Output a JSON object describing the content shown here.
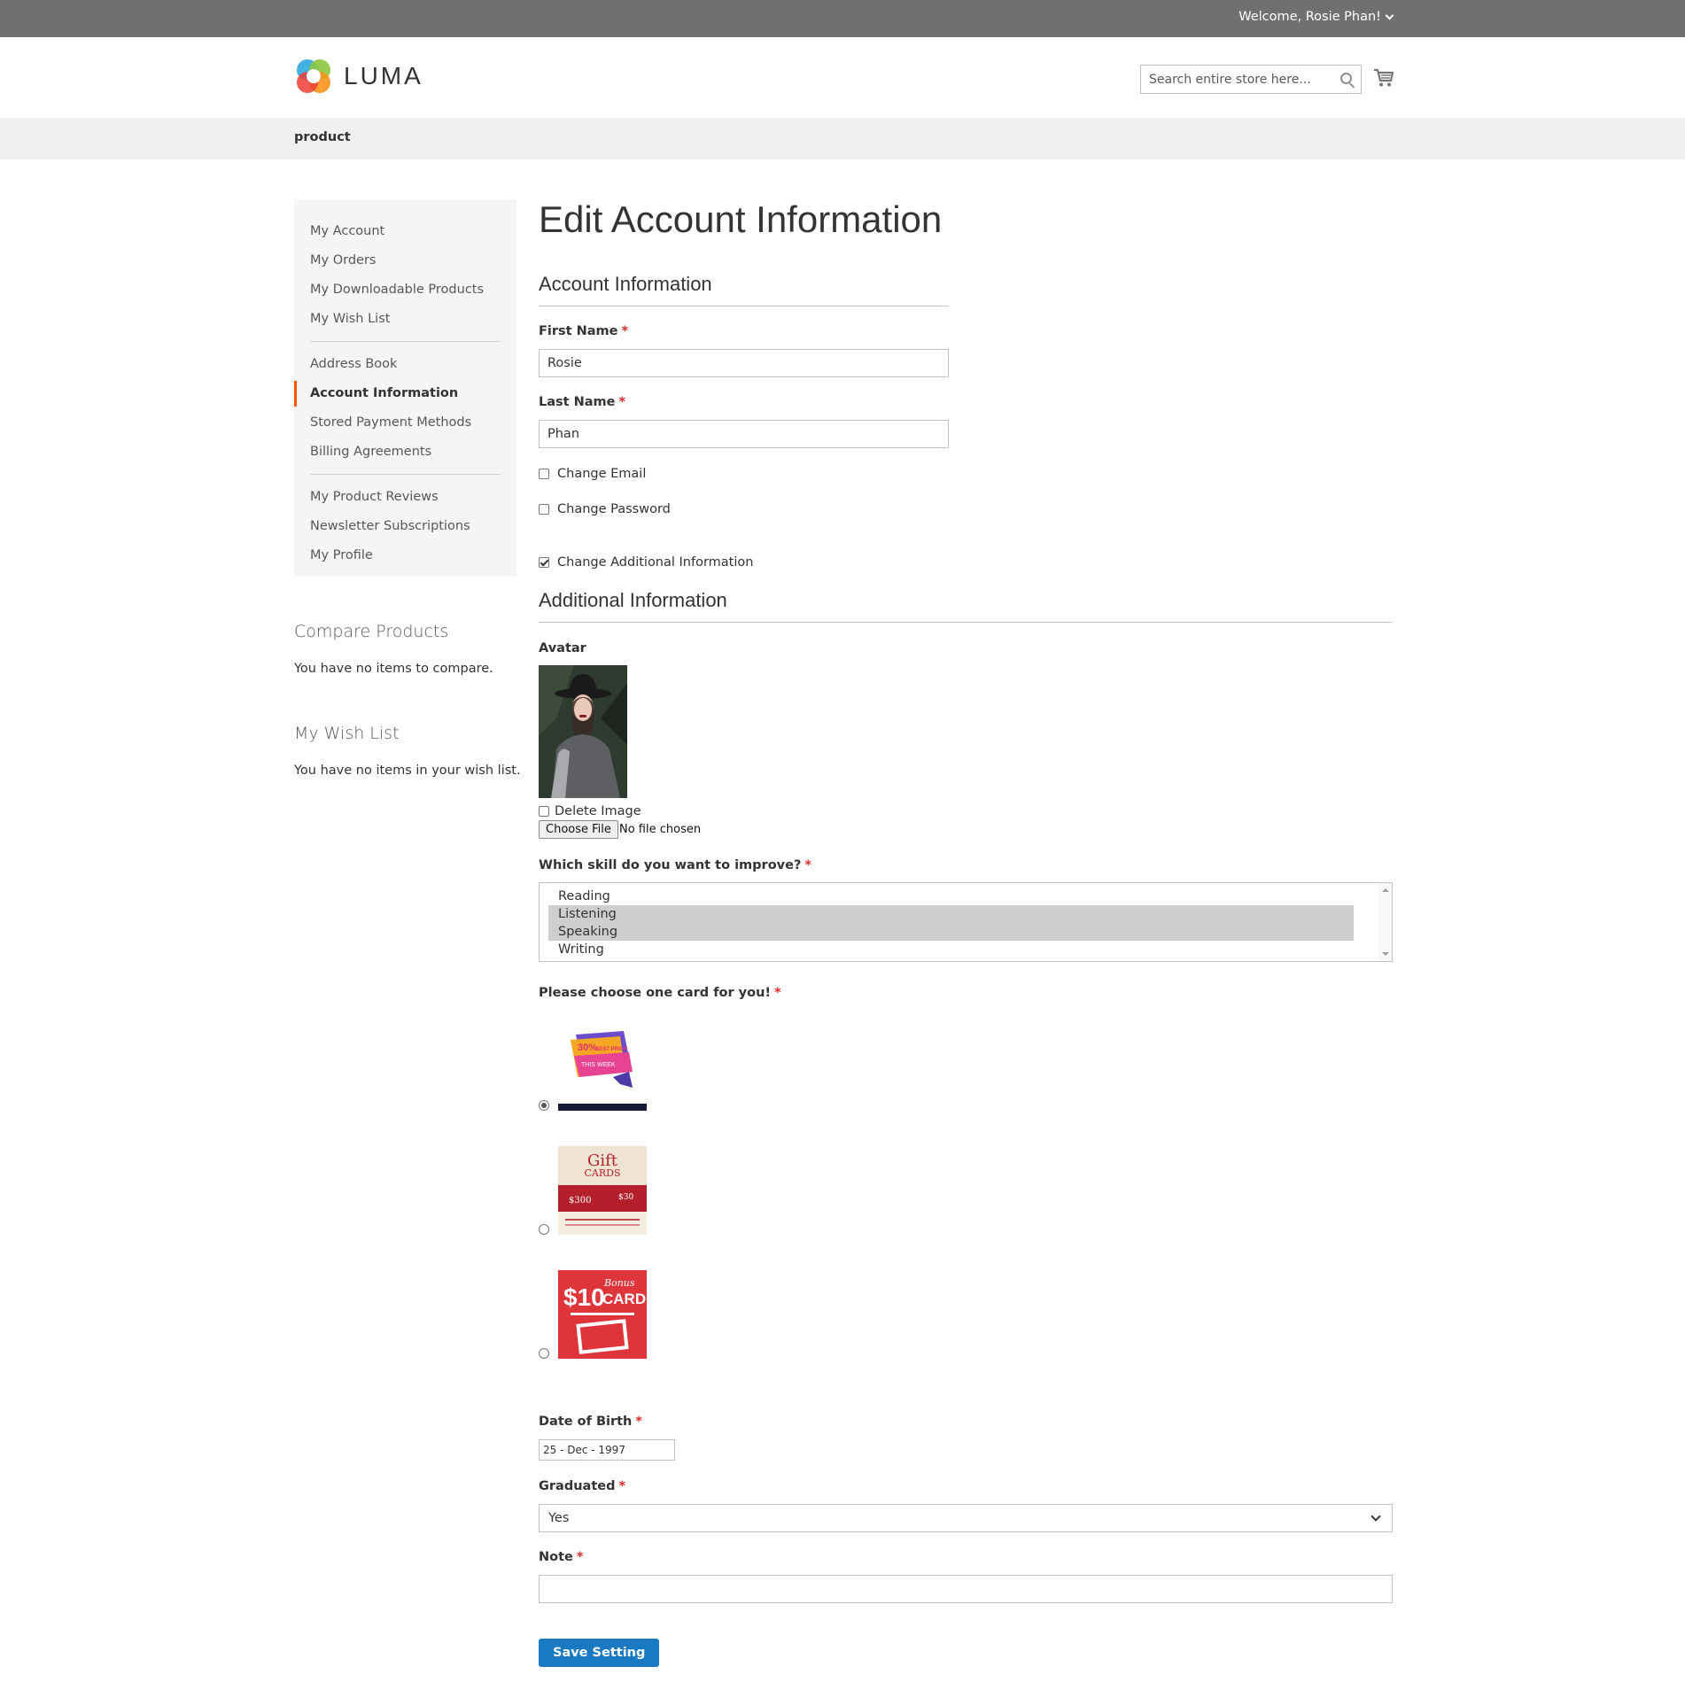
{
  "header": {
    "welcome": "Welcome, Rosie Phan!",
    "logo_text": "LUMA",
    "search_placeholder": "Search entire store here..."
  },
  "breadcrumb": "product",
  "sidebar": {
    "group1": [
      "My Account",
      "My Orders",
      "My Downloadable Products",
      "My Wish List"
    ],
    "group2": [
      "Address Book",
      "Account Information",
      "Stored Payment Methods",
      "Billing Agreements"
    ],
    "group3": [
      "My Product Reviews",
      "Newsletter Subscriptions",
      "My Profile"
    ],
    "active": "Account Information"
  },
  "compare": {
    "title": "Compare Products",
    "text": "You have no items to compare."
  },
  "wishlist": {
    "title": "My Wish List",
    "text": "You have no items in your wish list."
  },
  "page_title": "Edit Account Information",
  "account_info": {
    "legend": "Account Information",
    "first_name_label": "First Name",
    "first_name_value": "Rosie",
    "last_name_label": "Last Name",
    "last_name_value": "Phan",
    "change_email": "Change Email",
    "change_password": "Change Password",
    "change_additional": "Change Additional Information"
  },
  "additional": {
    "legend": "Additional Information",
    "avatar_label": "Avatar",
    "delete_image": "Delete Image",
    "choose_file": "Choose File",
    "no_file": "No file chosen",
    "skill_label": "Which skill do you want to improve?",
    "skills": [
      "Reading",
      "Listening",
      "Speaking",
      "Writing"
    ],
    "skills_selected": [
      "Listening",
      "Speaking"
    ],
    "card_label": "Please choose one card for you!",
    "card1_text_a": "30%",
    "card1_text_b": "BEST PRICE",
    "card1_text_c": "THIS WEEK",
    "card2_text_a": "Gift",
    "card2_text_b": "CARDS",
    "card2_text_c": "$300",
    "card2_text_d": "$30",
    "card3_text_a": "$10",
    "card3_text_b": "Bonus",
    "card3_text_c": "CARD",
    "dob_label": "Date of Birth",
    "dob_value": "25 - Dec - 1997",
    "graduated_label": "Graduated",
    "graduated_value": "Yes",
    "note_label": "Note",
    "note_value": "",
    "save_label": "Save Setting"
  },
  "colors": {
    "accent": "#1979c3",
    "active_marker": "#ff5501",
    "required": "#e02b27",
    "topbar": "#6e716e"
  }
}
